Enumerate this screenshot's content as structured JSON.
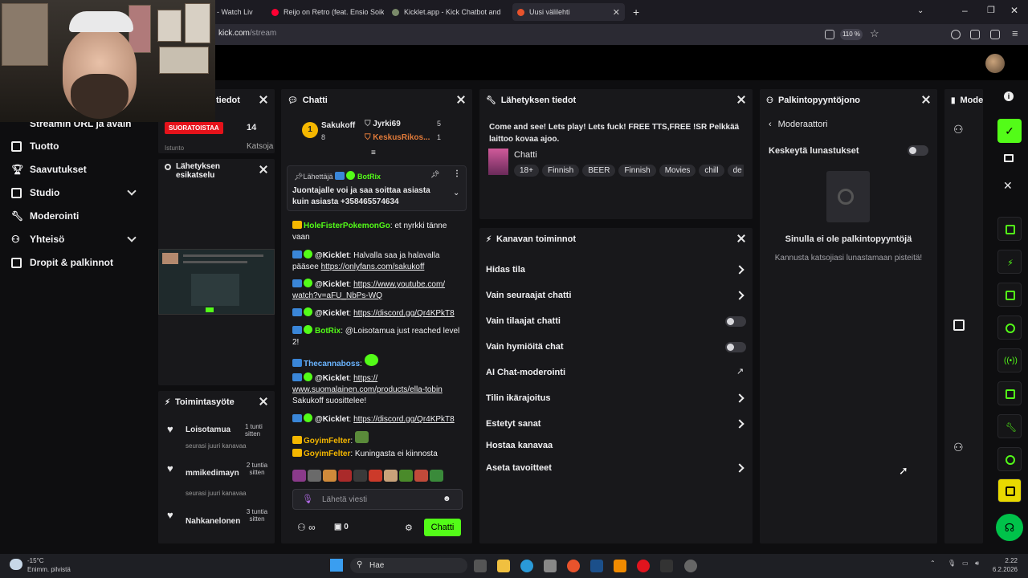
{
  "browser": {
    "tabs": [
      {
        "label": "- Watch Liv"
      },
      {
        "label": "Reijo on Retro (feat. Ensio Soik"
      },
      {
        "label": "Kicklet.app - Kick Chatbot and"
      },
      {
        "label": "Uusi välilehti"
      }
    ],
    "url_host": "kick.com",
    "url_path": "/stream",
    "zoom": "110 %"
  },
  "sidebar": {
    "items": [
      {
        "label": "Streamin URL ja avain"
      },
      {
        "label": "Tuotto"
      },
      {
        "label": "Saavutukset"
      },
      {
        "label": "Studio"
      },
      {
        "label": "Moderointi"
      },
      {
        "label": "Yhteisö"
      },
      {
        "label": "Dropit & palkinnot"
      }
    ]
  },
  "stream_info_mini": {
    "title": "tiedot",
    "live_badge": "SUORATOISTAA",
    "viewers": "14",
    "row_label": "Istunto",
    "row_label2": "Katsoja"
  },
  "preview": {
    "title": "Lähetyksen esikatselu"
  },
  "activity": {
    "title": "Toimintasyöte",
    "items": [
      {
        "name": "Loisotamua",
        "time": "1 tunti sitten",
        "event": "seurasi juuri kanavaa"
      },
      {
        "name": "mmikedimayn",
        "time": "2 tuntia sitten",
        "event": "seurasi juuri kanavaa"
      },
      {
        "name": "Nahkanelonen",
        "time": "3 tuntia sitten"
      }
    ]
  },
  "chat": {
    "title": "Chatti",
    "top_gifters": [
      {
        "rank": "1",
        "name": "Sakukoff",
        "count": "8"
      },
      {
        "name": "Jyrki69",
        "count": "5"
      },
      {
        "name": "KeskusRikos...",
        "count": "1"
      }
    ],
    "pinned": {
      "label": "Lähettäjä",
      "sender": "BotRix",
      "text": "Juontajalle voi ja saa soittaa asiasta kuin asiasta +358465574634"
    },
    "messages": [
      {
        "user": "HoleFisterPokemonGo",
        "text": ": et nyrkki tänne vaan"
      },
      {
        "user": "@Kicklet",
        "text": ": Halvalla saa ja halavalla pääsee ",
        "link": "https://onlyfans.com/sakukoff"
      },
      {
        "user": "@Kicklet",
        "text": ": ",
        "link": "https://www.youtube.com/ watch?v=aFU_NbPs-WQ"
      },
      {
        "user": "@Kicklet",
        "text": ": ",
        "link": "https://discord.gg/Qr4KPkT8"
      },
      {
        "user": "BotRix",
        "text": ": @Loisotamua just reached level 2!"
      },
      {
        "user": "Thecannaboss",
        "text": ":"
      },
      {
        "user": "@Kicklet",
        "text": ": ",
        "link": "https:// www.suomalainen.com/products/ella-tobin",
        "after": "Sakukoff suosittelee!"
      },
      {
        "user": "@Kicklet",
        "text": ": ",
        "link": "https://discord.gg/Qr4KPkT8"
      },
      {
        "user": "GoyimFelter",
        "text": ":"
      },
      {
        "user": "GoyimFelter",
        "text": ": Kuningasta ei kiinnosta"
      }
    ],
    "input_placeholder": "Lähetä viesti",
    "points": "0",
    "send_label": "Chatti"
  },
  "broadcast": {
    "title": "Lähetyksen tiedot",
    "stream_title": "Come and see! Lets play! Lets fuck! FREE TTS,FREE !SR Pelkkää laittoo kovaa ajoo.",
    "category": "Chatti",
    "tags": [
      "18+",
      "Finnish",
      "BEER",
      "Finnish",
      "Movies",
      "chill",
      "de"
    ]
  },
  "channel_actions": {
    "title": "Kanavan toiminnot",
    "rows": [
      {
        "label": "Hidas tila",
        "kind": "arrow"
      },
      {
        "label": "Vain seuraajat chatti",
        "kind": "arrow"
      },
      {
        "label": "Vain tilaajat chatti",
        "kind": "toggle"
      },
      {
        "label": "Vain hymiöitä chat",
        "kind": "toggle"
      },
      {
        "label": "AI Chat-moderointi",
        "kind": "external"
      },
      {
        "label": "Tilin ikärajoitus",
        "kind": "arrow"
      },
      {
        "label": "Estetyt sanat",
        "kind": "arrow"
      },
      {
        "label": "Hostaa kanavaa",
        "kind": "none"
      },
      {
        "label": "Aseta tavoitteet",
        "kind": "arrow"
      }
    ]
  },
  "rewards": {
    "title": "Palkintopyyntöjono",
    "back_label": "Moderaattori",
    "pause_label": "Keskeytä lunastukset",
    "empty_title": "Sinulla ei ole palkintopyyntöjä",
    "empty_sub": "Kannusta katsojiasi lunastamaan pisteitä!"
  },
  "mod_panel": {
    "title": "Mode"
  },
  "taskbar": {
    "weather_temp": "-15°C",
    "weather_desc": "Enimm. pilvistä",
    "search": "Hae",
    "time": "2.22",
    "date": "6.2.2026"
  }
}
